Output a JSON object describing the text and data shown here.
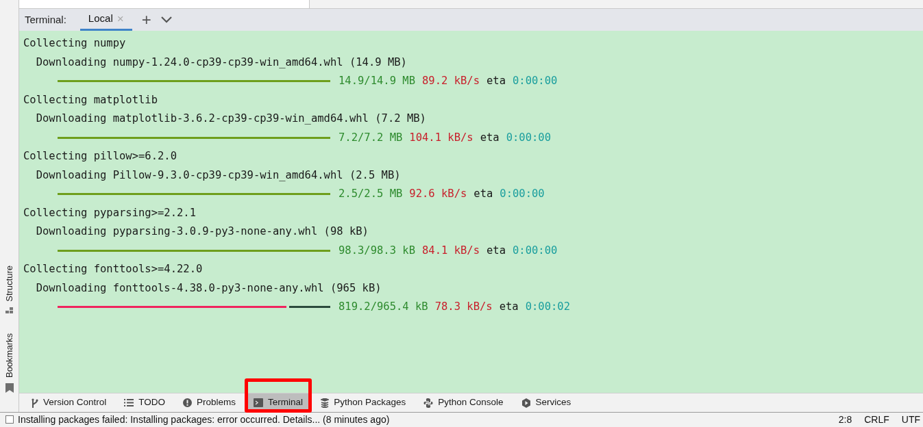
{
  "left_strip": [
    {
      "label": "Structure"
    },
    {
      "label": "Bookmarks"
    }
  ],
  "terminal_header": {
    "title": "Terminal:",
    "tabs": [
      {
        "label": "Local",
        "selected": true,
        "close": "×"
      }
    ],
    "add": "+"
  },
  "lines": [
    {
      "kind": "text",
      "text": "Collecting numpy"
    },
    {
      "kind": "text",
      "text": "  Downloading numpy-1.24.0-cp39-cp39-win_amd64.whl (14.9 MB)"
    },
    {
      "kind": "progress",
      "level": 1,
      "size": "14.9/14.9 MB",
      "speed": "89.2 kB/s",
      "eta_label": "eta",
      "eta": "0:00:00"
    },
    {
      "kind": "text",
      "text": "Collecting matplotlib"
    },
    {
      "kind": "text",
      "text": "  Downloading matplotlib-3.6.2-cp39-cp39-win_amd64.whl (7.2 MB)"
    },
    {
      "kind": "progress",
      "level": 1,
      "size": "7.2/7.2 MB",
      "speed": "104.1 kB/s",
      "eta_label": "eta",
      "eta": "0:00:00"
    },
    {
      "kind": "text",
      "text": "Collecting pillow>=6.2.0"
    },
    {
      "kind": "text",
      "text": "  Downloading Pillow-9.3.0-cp39-cp39-win_amd64.whl (2.5 MB)"
    },
    {
      "kind": "progress",
      "level": 1,
      "size": "2.5/2.5 MB",
      "speed": "92.6 kB/s",
      "eta_label": "eta",
      "eta": "0:00:00"
    },
    {
      "kind": "text",
      "text": "Collecting pyparsing>=2.2.1"
    },
    {
      "kind": "text",
      "text": "  Downloading pyparsing-3.0.9-py3-none-any.whl (98 kB)"
    },
    {
      "kind": "progress",
      "level": 1,
      "size": "98.3/98.3 kB",
      "speed": "84.1 kB/s",
      "eta_label": "eta",
      "eta": "0:00:00"
    },
    {
      "kind": "text",
      "text": "Collecting fonttools>=4.22.0"
    },
    {
      "kind": "text",
      "text": "  Downloading fonttools-4.38.0-py3-none-any.whl (965 kB)"
    },
    {
      "kind": "progress",
      "level": 0.84,
      "size": "819.2/965.4 kB",
      "speed": "78.3 kB/s",
      "eta_label": "eta",
      "eta": "0:00:02"
    }
  ],
  "tool_tabs": [
    {
      "label": "Version Control",
      "selected": false
    },
    {
      "label": "TODO",
      "selected": false
    },
    {
      "label": "Problems",
      "selected": false
    },
    {
      "label": "Terminal",
      "selected": true
    },
    {
      "label": "Python Packages",
      "selected": false
    },
    {
      "label": "Python Console",
      "selected": false
    },
    {
      "label": "Services",
      "selected": false
    }
  ],
  "status_bar": {
    "message": "Installing packages failed: Installing packages: error occurred. Details... (8 minutes ago)",
    "position": "2:8",
    "line_separator": "CRLF",
    "encoding": "UTF"
  }
}
